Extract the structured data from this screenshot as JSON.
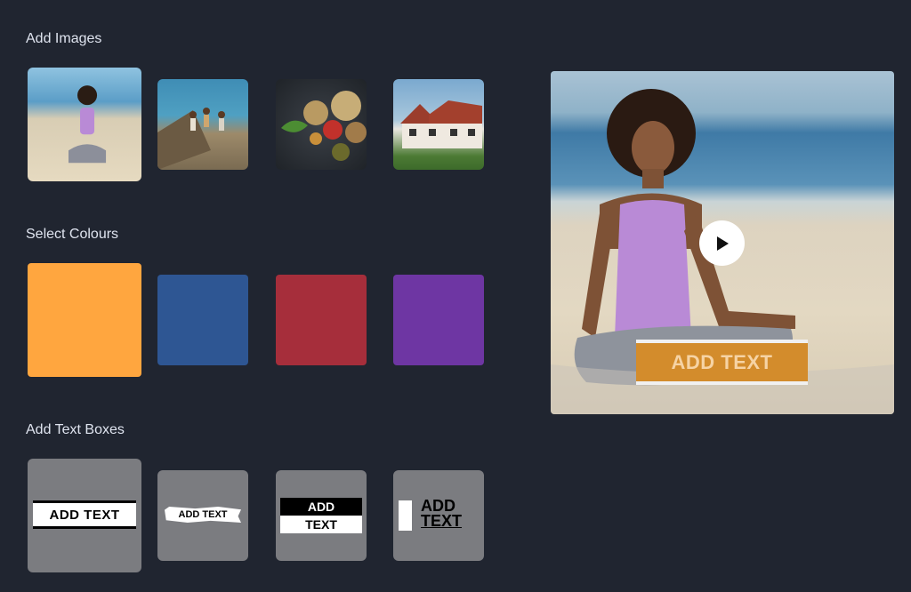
{
  "sections": {
    "images_title": "Add Images",
    "colours_title": "Select Colours",
    "textboxes_title": "Add Text Boxes"
  },
  "images": [
    {
      "icon": "meditating-woman-beach-photo"
    },
    {
      "icon": "friends-jumping-beach-photo"
    },
    {
      "icon": "food-bowls-photo"
    },
    {
      "icon": "tudor-house-photo"
    }
  ],
  "colours": [
    "#ffa63f",
    "#2e5693",
    "#a62e3b",
    "#6e36a3"
  ],
  "text_boxes": {
    "style1": "ADD TEXT",
    "style2": "ADD TEXT",
    "style3_top": "ADD",
    "style3_bottom": "TEXT",
    "style4_top": "ADD",
    "style4_bottom": "TEXT"
  },
  "preview": {
    "overlay_text": "ADD TEXT",
    "overlay_color": "#d38c2c",
    "play_icon": "play-icon"
  }
}
